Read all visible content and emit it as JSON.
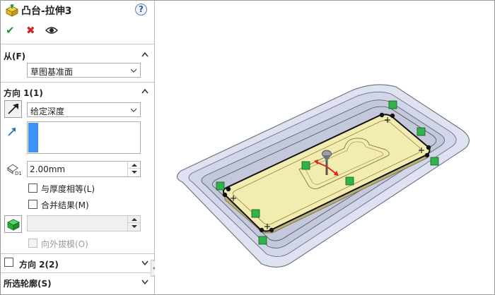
{
  "feature": {
    "title": "凸台-拉伸3",
    "help_label": "?",
    "ok_label": "✔",
    "cancel_label": "✖"
  },
  "from_section": {
    "label": "从(F)",
    "selected": "草图基准面"
  },
  "direction1": {
    "label": "方向 1(1)",
    "end_condition": "给定深度",
    "depth": "2.00mm",
    "equal_thickness_label": "与厚度相等(L)",
    "merge_result_label": "合并结果(M)",
    "draft_outward_label": "向外拔模(O)"
  },
  "direction2": {
    "label": "方向 2(2)"
  },
  "selected_contours": {
    "label": "所选轮廓(S)"
  },
  "colors": {
    "accent": "#3d93f5",
    "ok": "#1b9b2c",
    "cancel": "#d02020",
    "preview_fill": "#f3ecb0",
    "part_fill": "#dfe2f1",
    "handle": "#2fb34a"
  }
}
